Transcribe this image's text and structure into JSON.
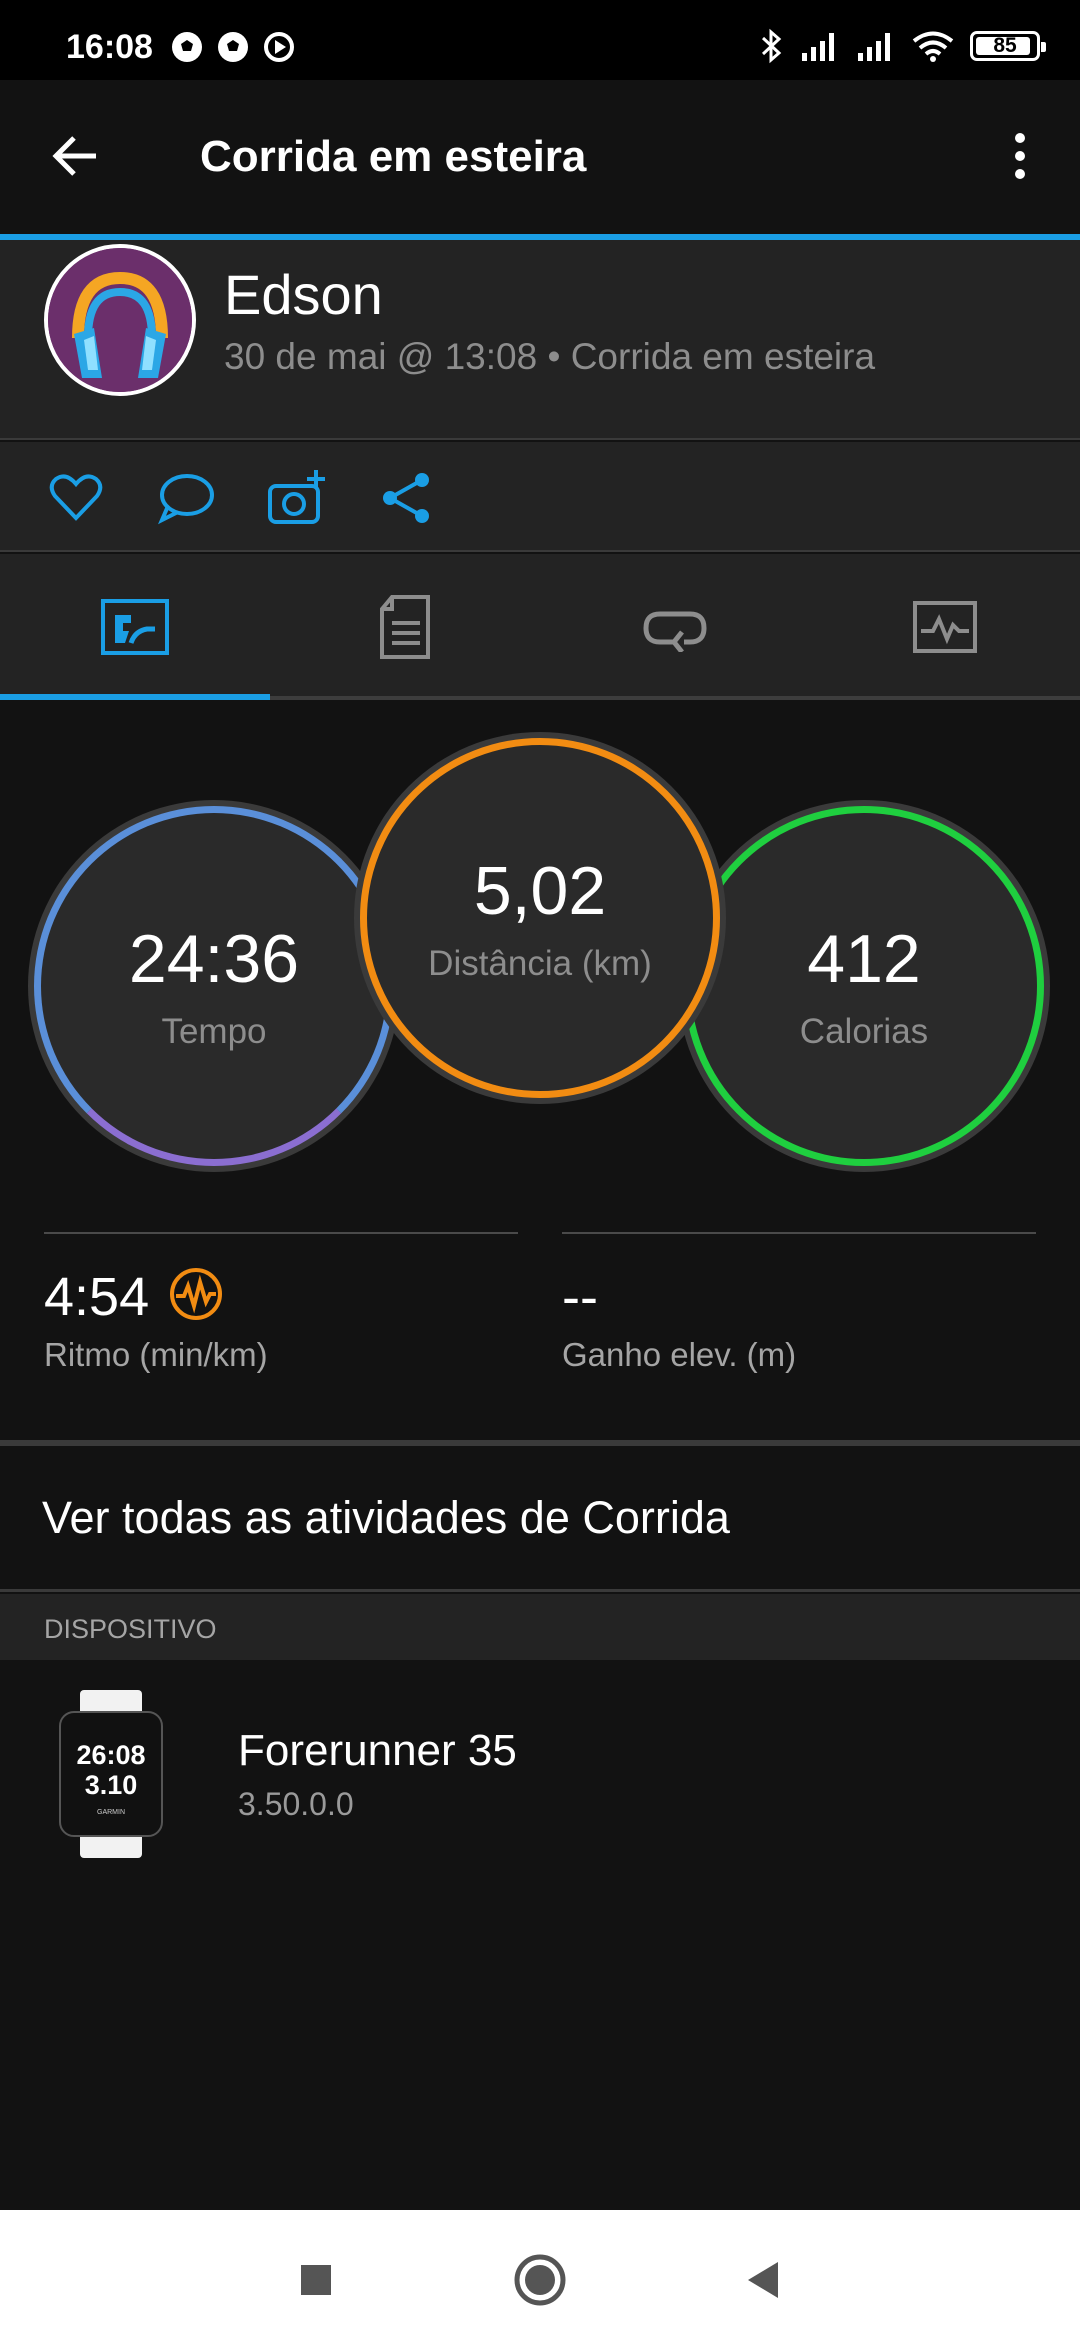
{
  "status_bar": {
    "time": "16:08",
    "battery": "85",
    "battery_level_percent": 85,
    "icons": [
      "soccer-ball-icon",
      "soccer-ball-icon",
      "play-circle-icon",
      "bluetooth-icon",
      "signal-icon",
      "signal-icon",
      "wifi-icon",
      "battery-icon"
    ]
  },
  "app_bar": {
    "title": "Corrida em esteira",
    "back_icon": "arrow-left-icon",
    "menu_icon": "more-vert-icon"
  },
  "profile": {
    "name": "Edson",
    "meta": "30 de mai @ 13:08 • Corrida em esteira"
  },
  "actions": [
    "heart-icon",
    "comment-icon",
    "add-photo-icon",
    "share-icon"
  ],
  "tabs": [
    {
      "icon": "stats-icon",
      "active": true
    },
    {
      "icon": "details-list-icon",
      "active": false
    },
    {
      "icon": "laps-loop-icon",
      "active": false
    },
    {
      "icon": "chart-icon",
      "active": false
    }
  ],
  "stats": {
    "time": {
      "value": "24:36",
      "label": "Tempo"
    },
    "distance": {
      "value": "5,02",
      "label": "Distância (km)"
    },
    "calories": {
      "value": "412",
      "label": "Calorias"
    }
  },
  "metrics": {
    "pace": {
      "value": "4:54",
      "label": "Ritmo (min/km)"
    },
    "elevation": {
      "value": "--",
      "label": "Ganho elev. (m)"
    }
  },
  "link": {
    "label": "Ver todas as atividades de Corrida"
  },
  "device_section": {
    "header": "DISPOSITIVO",
    "name": "Forerunner 35",
    "version": "3.50.0.0",
    "watch_face_time": "26:08",
    "watch_face_value": "3.10",
    "watch_brand": "GARMIN"
  },
  "colors": {
    "accent": "#1a9ee5",
    "time_ring": "#5a8fd9",
    "distance_ring": "#f28c12",
    "calories_ring": "#1fcf3f"
  }
}
